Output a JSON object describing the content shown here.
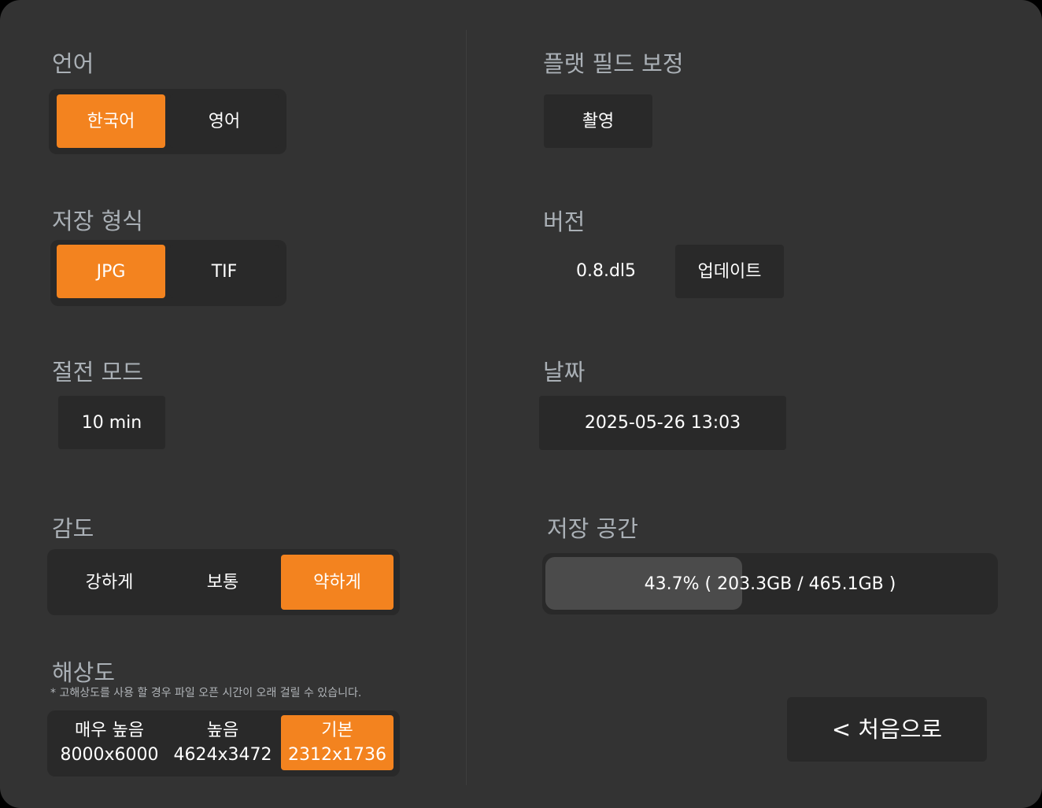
{
  "language": {
    "label": "언어",
    "options": [
      "한국어",
      "영어"
    ],
    "selected": 0
  },
  "format": {
    "label": "저장 형식",
    "options": [
      "JPG",
      "TIF"
    ],
    "selected": 0
  },
  "power_save": {
    "label": "절전 모드",
    "value": "10 min"
  },
  "sensitivity": {
    "label": "감도",
    "options": [
      "강하게",
      "보통",
      "약하게"
    ],
    "selected": 2
  },
  "resolution": {
    "label": "해상도",
    "note": "* 고해상도를 사용 할 경우 파일 오픈 시간이 오래 걸릴 수 있습니다.",
    "options": [
      {
        "name": "매우 높음",
        "size": "8000x6000"
      },
      {
        "name": "높음",
        "size": "4624x3472"
      },
      {
        "name": "기본",
        "size": "2312x1736"
      }
    ],
    "selected": 2
  },
  "flat_field": {
    "label": "플랫 필드 보정",
    "button": "촬영"
  },
  "version": {
    "label": "버전",
    "value": "0.8.dl5",
    "button": "업데이트"
  },
  "date": {
    "label": "날짜",
    "value": "2025-05-26 13:03"
  },
  "storage": {
    "label": "저장 공간",
    "percent": 43.7,
    "text": "43.7% ( 203.3GB / 465.1GB )"
  },
  "back_button": "< 처음으로",
  "colors": {
    "accent": "#f3831f",
    "background": "#333333",
    "panel": "#292929"
  }
}
